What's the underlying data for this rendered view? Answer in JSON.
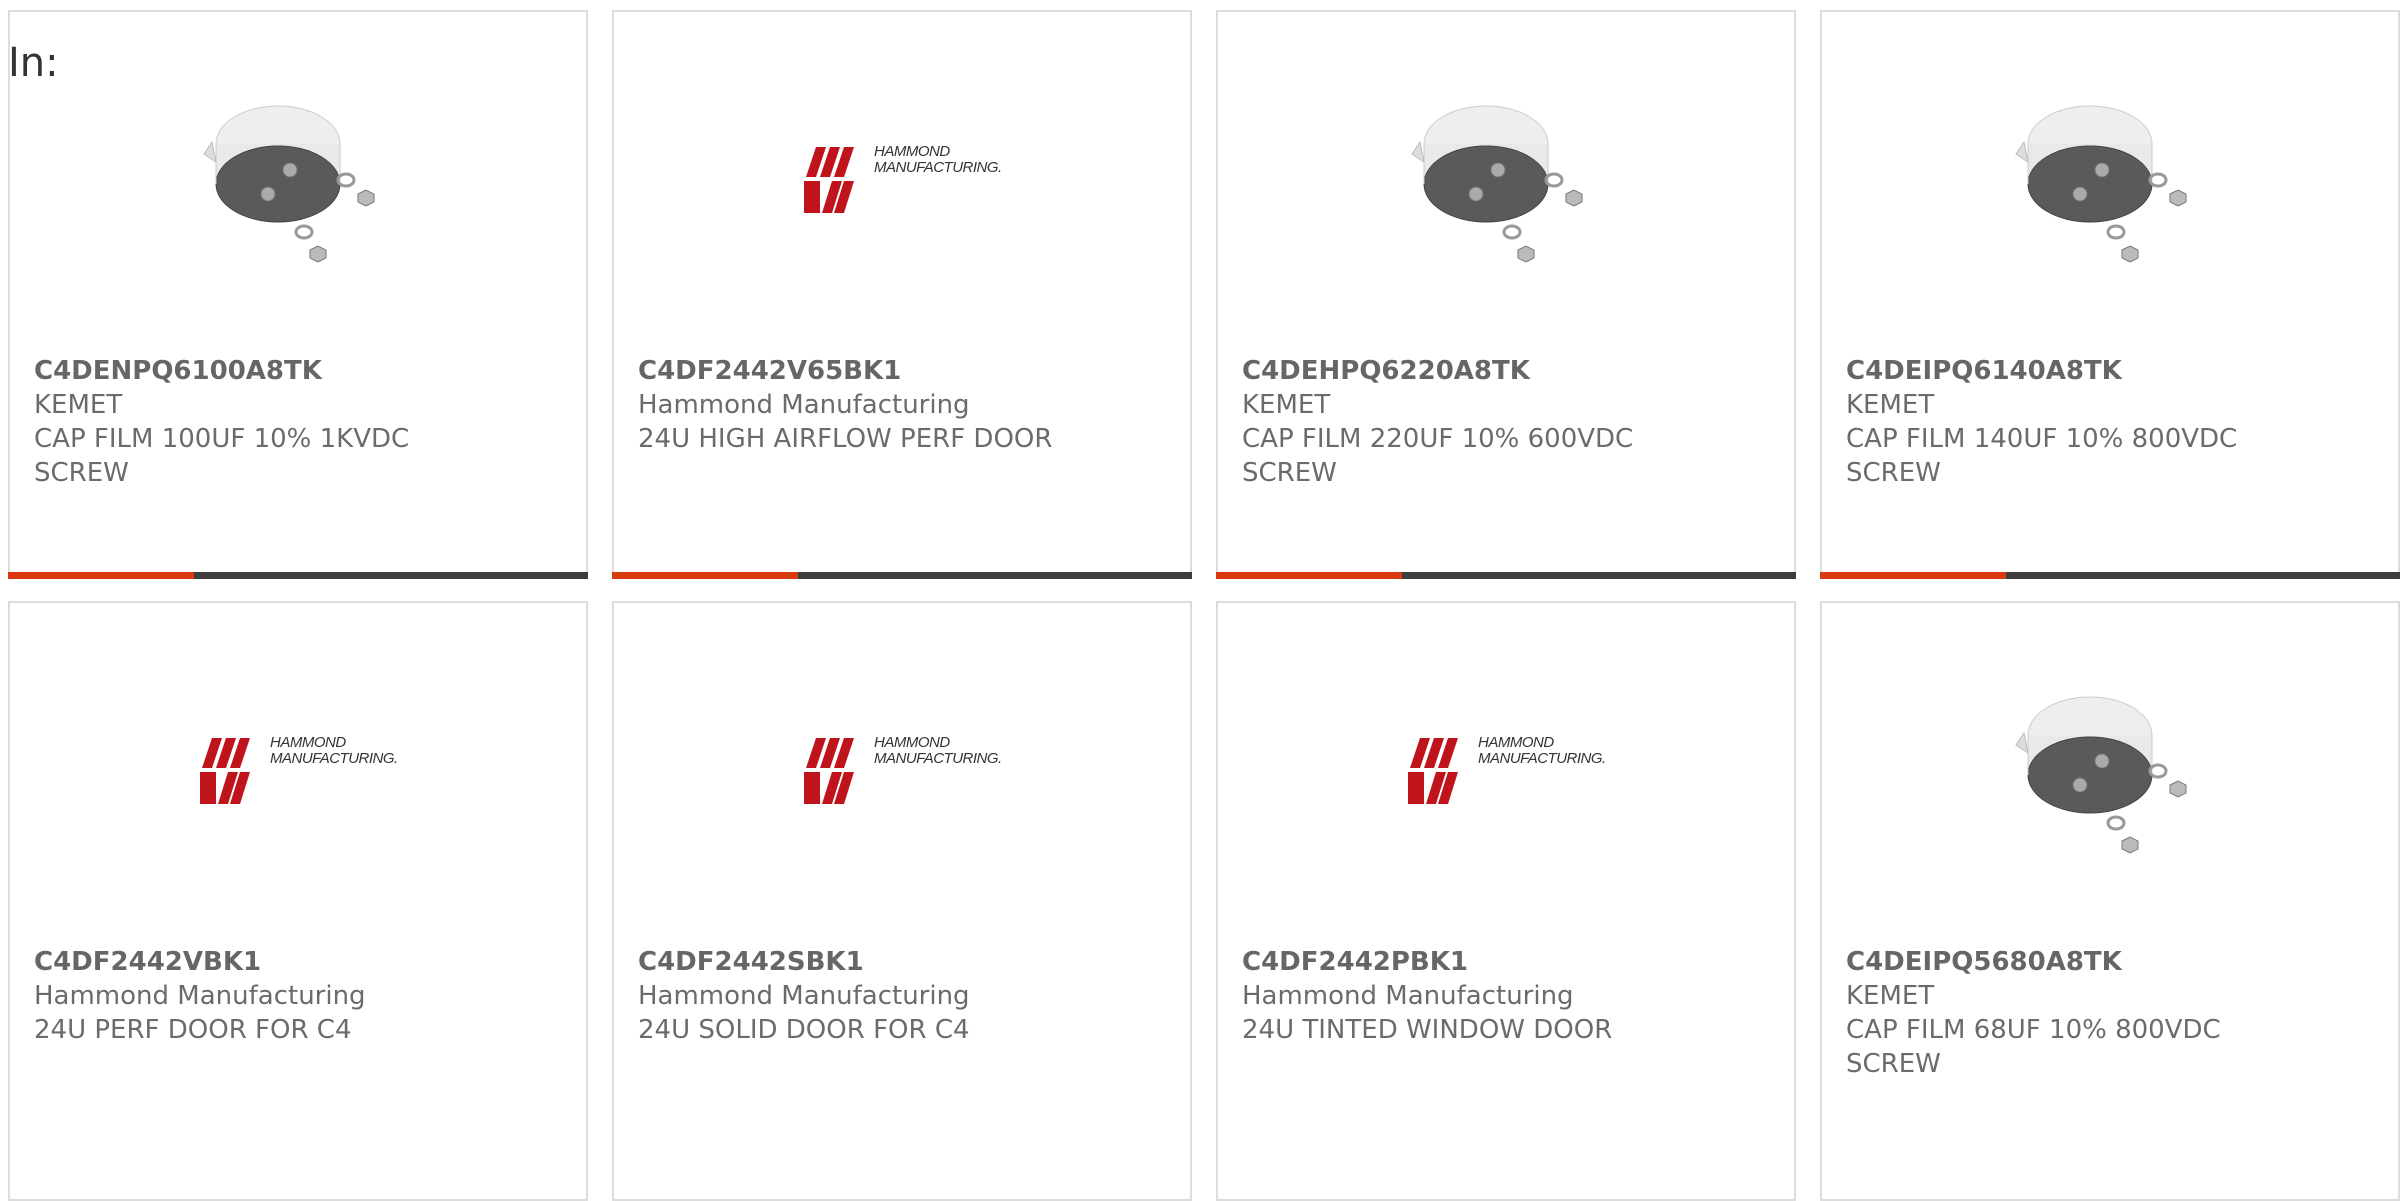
{
  "header": {
    "in_label": "In:"
  },
  "colors": {
    "accent": "#d93a10",
    "bar_track": "#3d3d3d",
    "logo_red": "#c0141c",
    "border": "#dddddd"
  },
  "progress_fraction": 0.32,
  "products": [
    {
      "part_number": "C4DENPQ6100A8TK",
      "manufacturer": "KEMET",
      "description": "CAP FILM 100UF 10% 1KVDC",
      "description_line2": "SCREW",
      "image": "film-capacitor-image"
    },
    {
      "part_number": "C4DF2442V65BK1",
      "manufacturer": "Hammond Manufacturing",
      "description": "24U HIGH AIRFLOW PERF DOOR",
      "description_line2": "",
      "image": "hammond-logo",
      "logo_text": [
        "HAMMOND",
        "MANUFACTURING."
      ]
    },
    {
      "part_number": "C4DEHPQ6220A8TK",
      "manufacturer": "KEMET",
      "description": "CAP FILM 220UF 10% 600VDC",
      "description_line2": "SCREW",
      "image": "film-capacitor-image"
    },
    {
      "part_number": "C4DEIPQ6140A8TK",
      "manufacturer": "KEMET",
      "description": "CAP FILM 140UF 10% 800VDC",
      "description_line2": "SCREW",
      "image": "film-capacitor-image"
    },
    {
      "part_number": "C4DF2442VBK1",
      "manufacturer": "Hammond Manufacturing",
      "description": "24U PERF DOOR FOR C4",
      "description_line2": "",
      "image": "hammond-logo",
      "logo_text": [
        "HAMMOND",
        "MANUFACTURING."
      ]
    },
    {
      "part_number": "C4DF2442SBK1",
      "manufacturer": "Hammond Manufacturing",
      "description": "24U SOLID DOOR FOR C4",
      "description_line2": "",
      "image": "hammond-logo",
      "logo_text": [
        "HAMMOND",
        "MANUFACTURING."
      ]
    },
    {
      "part_number": "C4DF2442PBK1",
      "manufacturer": "Hammond Manufacturing",
      "description": "24U TINTED WINDOW DOOR",
      "description_line2": "",
      "image": "hammond-logo",
      "logo_text": [
        "HAMMOND",
        "MANUFACTURING."
      ]
    },
    {
      "part_number": "C4DEIPQ5680A8TK",
      "manufacturer": "KEMET",
      "description": "CAP FILM 68UF 10% 800VDC",
      "description_line2": "SCREW",
      "image": "film-capacitor-image"
    }
  ]
}
